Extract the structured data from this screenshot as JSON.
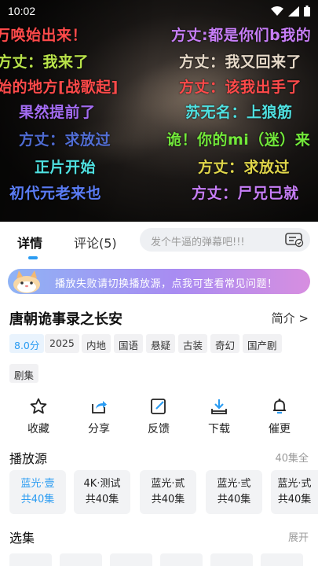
{
  "status": {
    "time": "10:02"
  },
  "danmaku": [
    {
      "text": "万唤始出来！",
      "color": "#ff4a4a"
    },
    {
      "text": "方丈:都是你们b我的",
      "color": "#c77ef7"
    },
    {
      "text": "方丈：我来了",
      "color": "#b9e34a"
    },
    {
      "text": "方丈：我又回来了",
      "color": "#e6d9c8"
    },
    {
      "text": "始的地方[战歌起]",
      "color": "#ff4a4a"
    },
    {
      "text": "方丈：该我出手了",
      "color": "#ff4a4a"
    },
    {
      "text": "果然提前了",
      "color": "#a36cf2"
    },
    {
      "text": "苏无名：上狼筋",
      "color": "#4fe0e0"
    },
    {
      "text": "方丈：求放过",
      "color": "#5a7cf4"
    },
    {
      "text": "诡！你的mi（迷）来",
      "color": "#72e83a"
    },
    {
      "text": "正片开始",
      "color": "#4fe0e0"
    },
    {
      "text": "方丈：求放过",
      "color": "#e0d64a"
    },
    {
      "text": "初代元老来也",
      "color": "#5a7cf4"
    },
    {
      "text": "方丈：尸兄已就",
      "color": "#c77ef7"
    }
  ],
  "tabs": {
    "detail": "详情",
    "comments": "评论(5)"
  },
  "danmu_input": {
    "placeholder": "发个牛逼的弹幕吧!!!"
  },
  "banner": {
    "text": "播放失败请切换播放源，点我可查看常见问题！"
  },
  "show": {
    "title": "唐朝诡事录之长安",
    "intro_link": "简介 >",
    "tags": [
      "8.0分",
      "2025",
      "内地",
      "国语",
      "悬疑",
      "古装",
      "奇幻",
      "国产剧",
      "剧集"
    ]
  },
  "actions": [
    {
      "label": "收藏",
      "icon": "star-icon"
    },
    {
      "label": "分享",
      "icon": "share-icon"
    },
    {
      "label": "反馈",
      "icon": "edit-icon"
    },
    {
      "label": "下载",
      "icon": "download-icon"
    },
    {
      "label": "催更",
      "icon": "bell-icon"
    }
  ],
  "sources": {
    "title": "播放源",
    "count": "40集全",
    "items": [
      {
        "name": "蓝光·壹",
        "eps": "共40集",
        "active": true
      },
      {
        "name": "4K·测试",
        "eps": "共40集",
        "active": false
      },
      {
        "name": "蓝光·贰",
        "eps": "共40集",
        "active": false
      },
      {
        "name": "蓝光·弎",
        "eps": "共40集",
        "active": false
      },
      {
        "name": "蓝光·式",
        "eps": "共40集",
        "active": false
      }
    ]
  },
  "episodes": {
    "title": "选集",
    "expand": "展开"
  },
  "colors": {
    "accent": "#2b9cf2"
  }
}
